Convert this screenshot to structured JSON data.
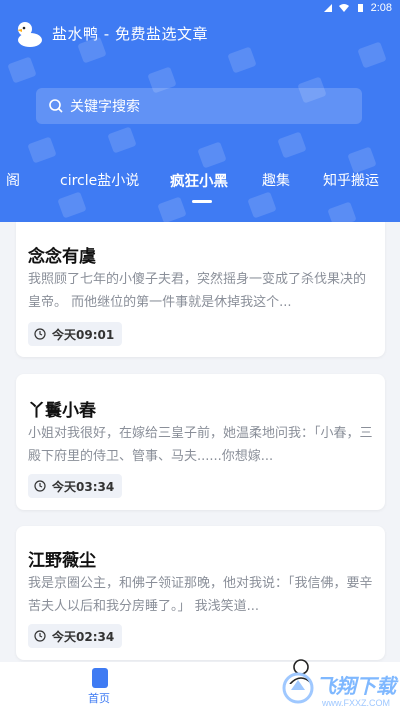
{
  "status_bar": {
    "time": "2:08"
  },
  "app": {
    "title": "盐水鸭 - 免费盐选文章"
  },
  "search": {
    "placeholder": "关键字搜索"
  },
  "tabs": [
    {
      "label": "阁",
      "active": false
    },
    {
      "label": "circle盐小说",
      "active": false
    },
    {
      "label": "疯狂小黑",
      "active": true
    },
    {
      "label": "趣集",
      "active": false
    },
    {
      "label": "知乎搬运",
      "active": false
    }
  ],
  "articles": [
    {
      "title": "念念有虞",
      "excerpt": "我照顾了七年的小傻子夫君，突然摇身一变成了杀伐果决的皇帝。 而他继位的第一件事就是休掉我这个...",
      "time": "今天09:01"
    },
    {
      "title": "丫鬟小春",
      "excerpt": "小姐对我很好，在嫁给三皇子前，她温柔地问我：「小春，三殿下府里的侍卫、管事、马夫......你想嫁...",
      "time": "今天03:34"
    },
    {
      "title": "江野薇尘",
      "excerpt": "我是京圈公主，和佛子领证那晚，他对我说：「我信佛，要辛苦夫人以后和我分房睡了。」 我浅笑道...",
      "time": "今天02:34"
    }
  ],
  "bottom_nav": {
    "home_label": "首页"
  },
  "watermark": {
    "text": "飞翔下载",
    "sub": "www.FXXZ.COM"
  },
  "colors": {
    "accent": "#3f7bf3",
    "background": "#f2f4f8"
  }
}
